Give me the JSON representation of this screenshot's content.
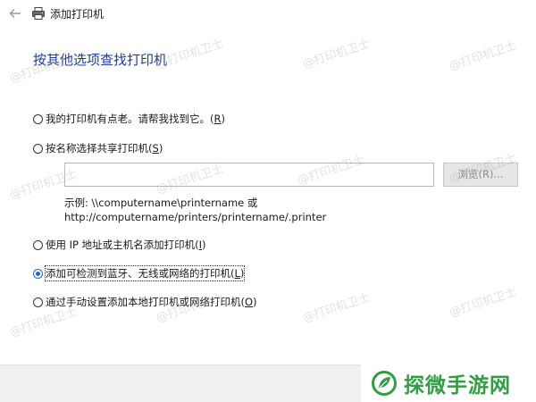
{
  "window": {
    "title": "添加打印机"
  },
  "heading": "按其他选项查找打印机",
  "options": [
    {
      "text": "我的打印机有点老。请帮我找到它。(",
      "key": "R",
      "close": ")",
      "checked": false
    },
    {
      "text": "按名称选择共享打印机(",
      "key": "S",
      "close": ")",
      "checked": false
    },
    {
      "text": "使用 IP 地址或主机名添加打印机(",
      "key": "I",
      "close": ")",
      "checked": false
    },
    {
      "text": "添加可检测到蓝牙、无线或网络的打印机(",
      "key": "L",
      "close": ")",
      "checked": true
    },
    {
      "text": "通过手动设置添加本地打印机或网络打印机(",
      "key": "O",
      "close": ")",
      "checked": false
    }
  ],
  "share_input": {
    "value": ""
  },
  "browse_button": {
    "label": "浏览(R)..."
  },
  "example": {
    "line1": "示例: \\\\computername\\printername 或",
    "line2": "http://computername/printers/printername/.printer"
  },
  "watermark": "@打印机卫士",
  "brand": {
    "name": "探微手游网"
  },
  "colors": {
    "heading": "#1f3d9a",
    "radio_selected": "#1e66d8",
    "brand_green": "#2fa042"
  },
  "icons": {
    "back": "back-arrow-icon",
    "printer": "printer-icon",
    "brand": "leaf-logo-icon"
  }
}
